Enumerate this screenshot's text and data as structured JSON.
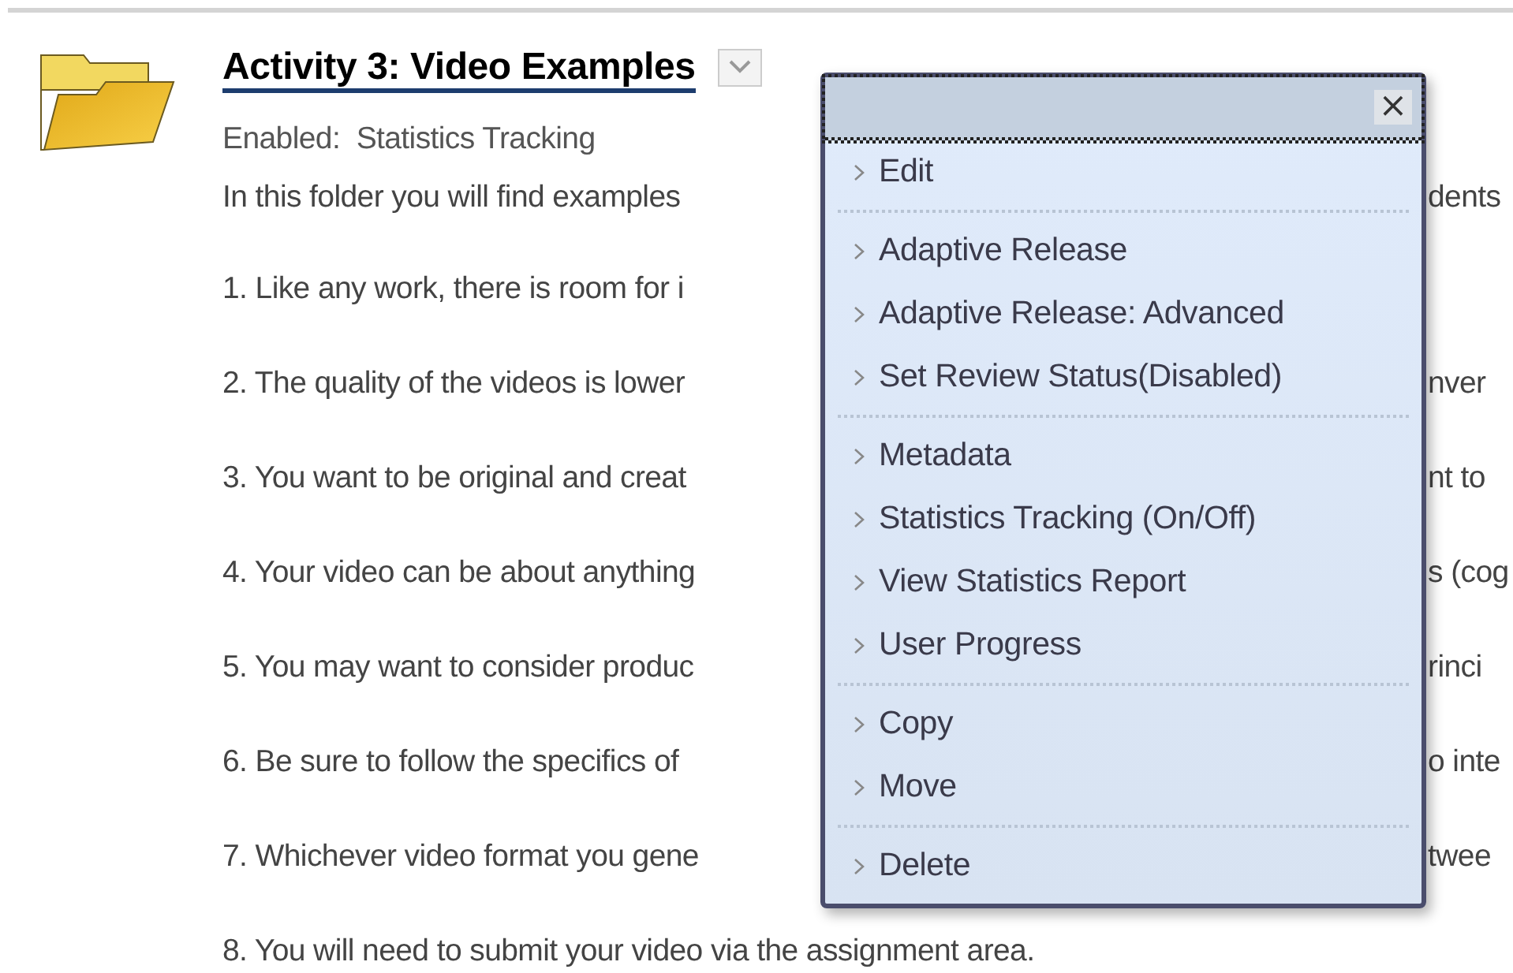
{
  "item": {
    "title": "Activity 3: Video Examples",
    "enabled": "Enabled:  Statistics Tracking",
    "lines": [
      {
        "left": "In this folder you will find examples",
        "right": "dents",
        "kind": "intro"
      },
      {
        "left": "1. Like any work, there is room for i",
        "kind": "point"
      },
      {
        "left": "2. The quality of the videos is lower",
        "right": "nver",
        "kind": "point"
      },
      {
        "left": "3. You want to be original and creat",
        "right": "nt to",
        "kind": "point"
      },
      {
        "left": "4. Your video can be about anything",
        "right": "s (cog",
        "kind": "point"
      },
      {
        "left": "5. You may want to consider produc",
        "right": "rinci",
        "kind": "point"
      },
      {
        "left": "6. Be sure to follow the specifics of",
        "right": "o inte",
        "kind": "point"
      },
      {
        "left": "7. Whichever video format you gene",
        "right": "twee",
        "kind": "point"
      },
      {
        "left": "8. You will need to submit your video via the assignment area.",
        "kind": "point"
      }
    ]
  },
  "menu": {
    "close": "×",
    "groups": [
      [
        "Edit"
      ],
      [
        "Adaptive Release",
        "Adaptive Release: Advanced",
        "Set Review Status(Disabled)"
      ],
      [
        "Metadata",
        "Statistics Tracking (On/Off)",
        "View Statistics Report",
        "User Progress"
      ],
      [
        "Copy",
        "Move"
      ],
      [
        "Delete"
      ]
    ]
  }
}
